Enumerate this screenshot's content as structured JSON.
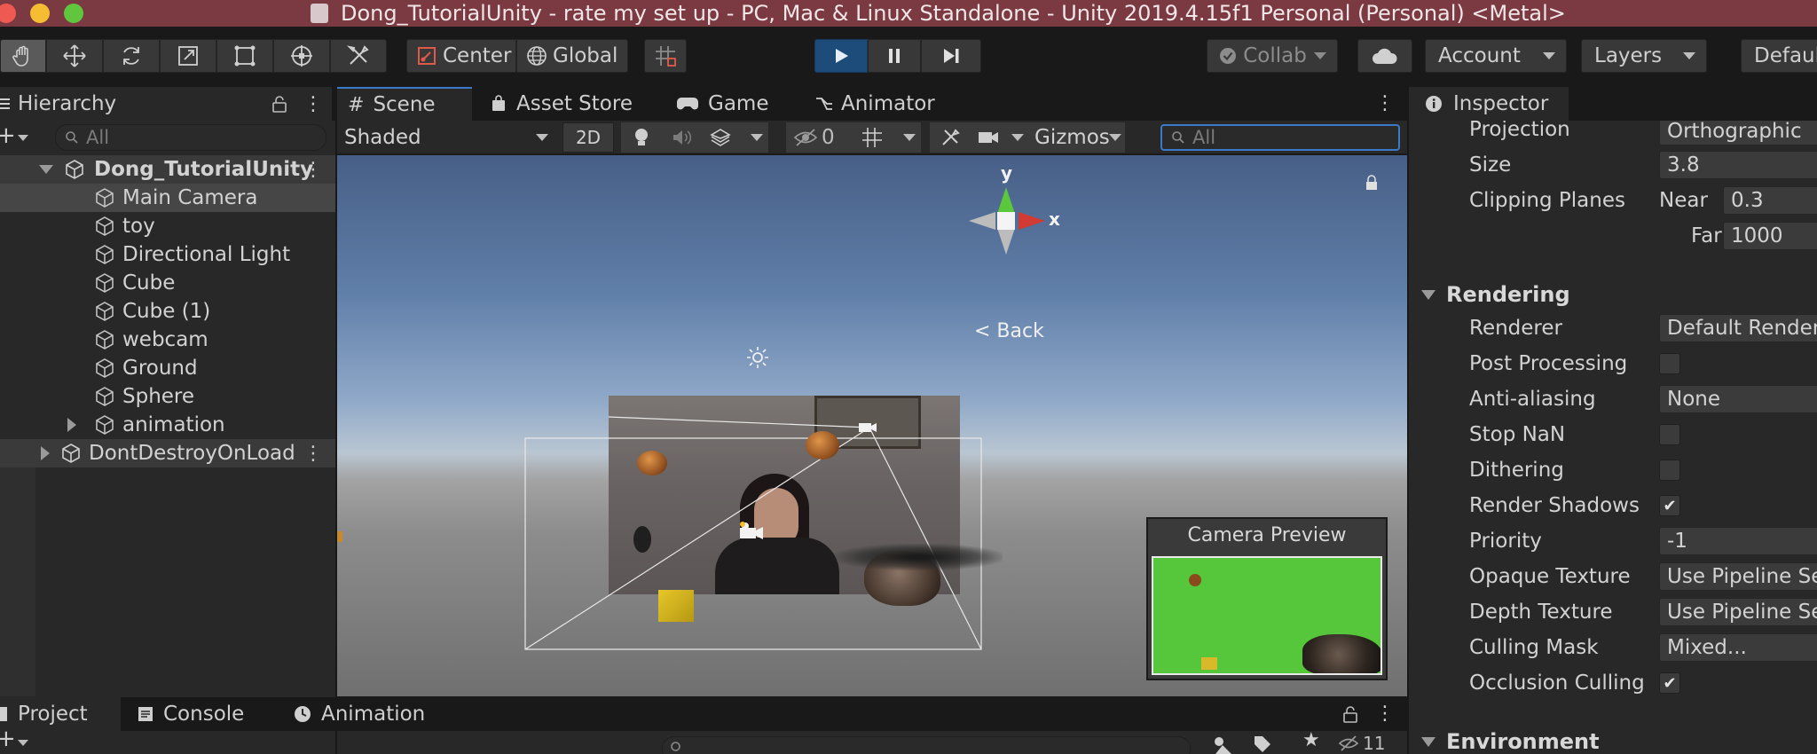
{
  "window": {
    "title": "Dong_TutorialUnity - rate my set up - PC, Mac & Linux Standalone - Unity 2019.4.15f1 Personal (Personal) <Metal>"
  },
  "toolbar": {
    "pivot_label": "Center",
    "space_label": "Global",
    "collab_label": "Collab",
    "account_label": "Account",
    "layers_label": "Layers",
    "layout_label": "Defaul"
  },
  "hierarchy": {
    "tab_label": "Hierarchy",
    "search_placeholder": "All",
    "scene_name": "Dong_TutorialUnity",
    "items": [
      {
        "label": "Main Camera",
        "selected": true
      },
      {
        "label": "toy"
      },
      {
        "label": "Directional Light"
      },
      {
        "label": "Cube"
      },
      {
        "label": "Cube (1)"
      },
      {
        "label": "webcam"
      },
      {
        "label": "Ground"
      },
      {
        "label": "Sphere"
      },
      {
        "label": "animation",
        "expandable": true
      }
    ],
    "ddol_name": "DontDestroyOnLoad"
  },
  "scene_tabs": [
    {
      "label": "Scene",
      "active": true
    },
    {
      "label": "Asset Store"
    },
    {
      "label": "Game"
    },
    {
      "label": "Animator"
    }
  ],
  "scene_toolbar": {
    "shading_mode": "Shaded",
    "mode_2d": "2D",
    "hidden_count": "0",
    "gizmos_label": "Gizmos",
    "search_placeholder": "All"
  },
  "scene_view": {
    "gizmo_y": "y",
    "gizmo_x": "x",
    "back_label": "< Back",
    "camera_preview_title": "Camera Preview"
  },
  "inspector": {
    "tab_label": "Inspector",
    "rows": {
      "projection": {
        "label": "Projection",
        "value": "Orthographic"
      },
      "size": {
        "label": "Size",
        "value": "3.8"
      },
      "clipping": {
        "label": "Clipping Planes",
        "near_label": "Near",
        "near": "0.3",
        "far_label": "Far",
        "far": "1000"
      }
    },
    "rendering_section": "Rendering",
    "rendering": {
      "renderer": {
        "label": "Renderer",
        "value": "Default Rendere"
      },
      "post_processing": {
        "label": "Post Processing",
        "checked": false
      },
      "anti_aliasing": {
        "label": "Anti-aliasing",
        "value": "None"
      },
      "stop_nan": {
        "label": "Stop NaN",
        "checked": false
      },
      "dithering": {
        "label": "Dithering",
        "checked": false
      },
      "render_shadows": {
        "label": "Render Shadows",
        "checked": true
      },
      "priority": {
        "label": "Priority",
        "value": "-1"
      },
      "opaque_texture": {
        "label": "Opaque Texture",
        "value": "Use Pipeline Se"
      },
      "depth_texture": {
        "label": "Depth Texture",
        "value": "Use Pipeline Se"
      },
      "culling_mask": {
        "label": "Culling Mask",
        "value": "Mixed..."
      },
      "occlusion_culling": {
        "label": "Occlusion Culling",
        "checked": true
      }
    },
    "environment_section": "Environment"
  },
  "bottom_tabs": [
    {
      "label": "Project",
      "active": true
    },
    {
      "label": "Console"
    },
    {
      "label": "Animation"
    }
  ],
  "bottom_toolbar": {
    "hidden_count": "11"
  },
  "colors": {
    "titlebar": "#7b3a41",
    "play_active": "#1e4c7a",
    "ground_green": "#56c63a"
  }
}
